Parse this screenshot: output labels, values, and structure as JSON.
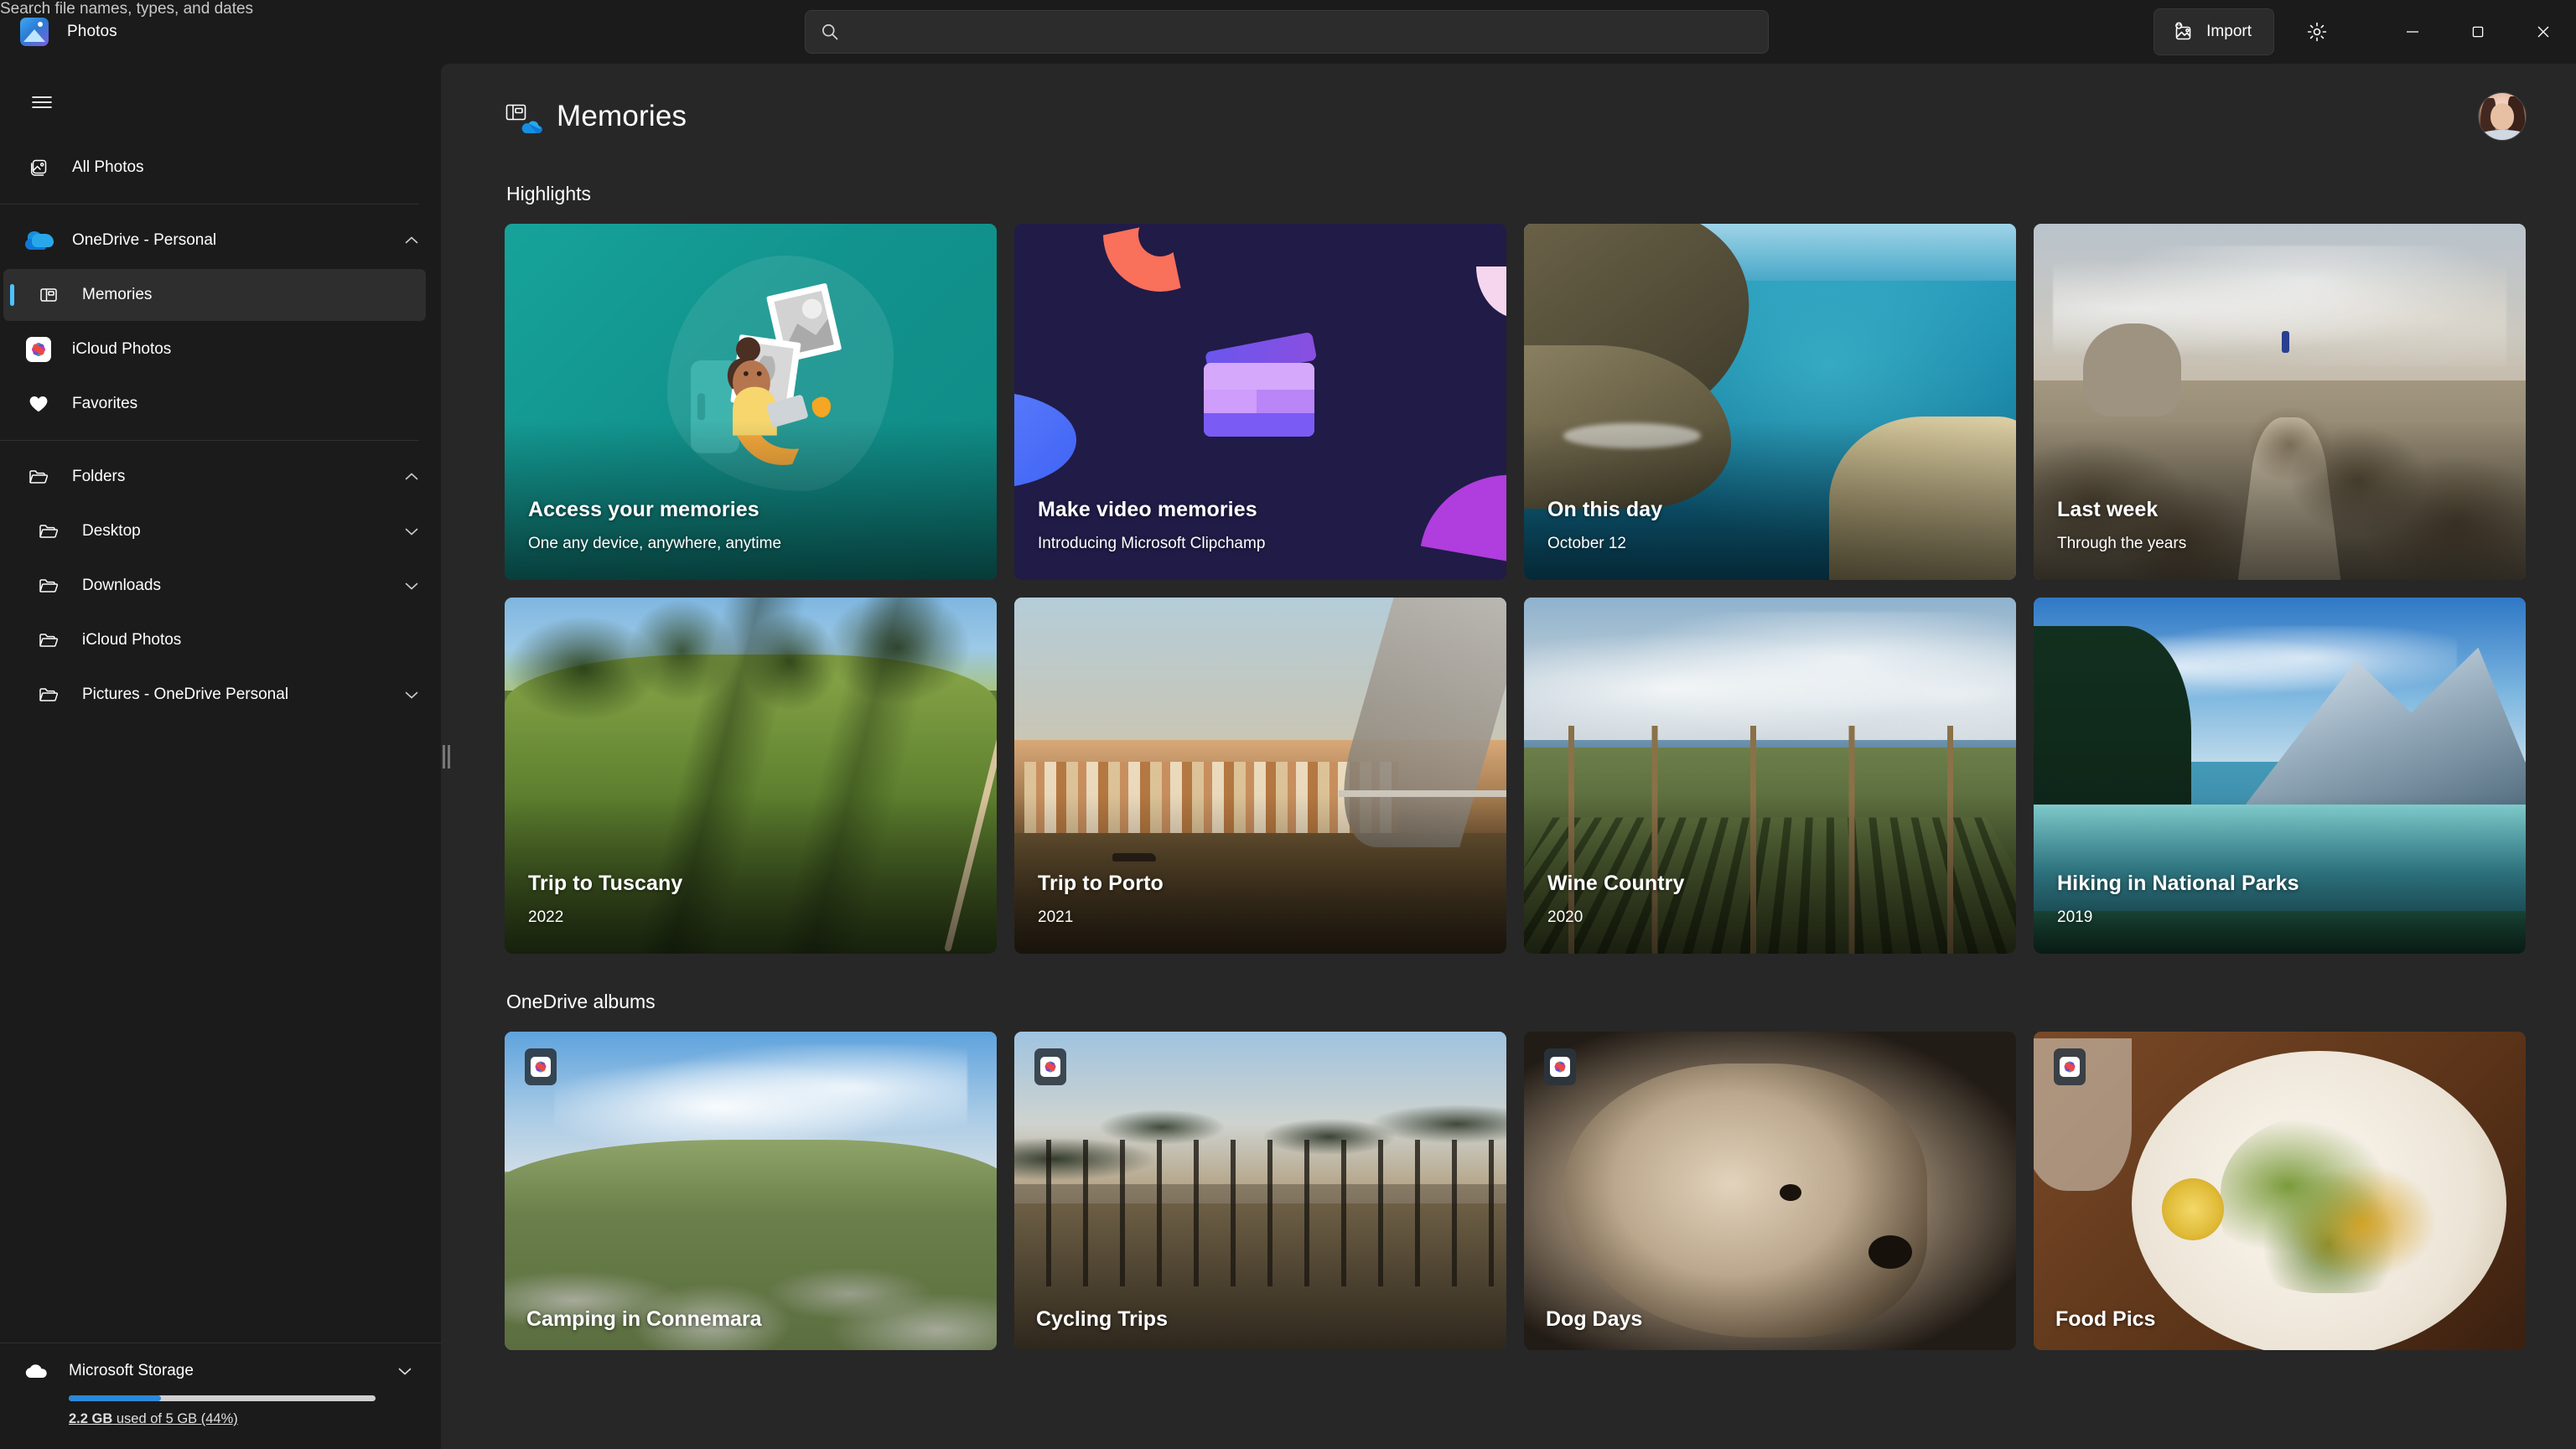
{
  "titlebar": {
    "app_name": "Photos",
    "app_icon": "photos-app-icon",
    "search": {
      "icon": "search-icon",
      "placeholder": "Search file names, types, and dates",
      "value": ""
    },
    "import_label": "Import",
    "import_icon": "import-image-icon",
    "settings_icon": "gear-icon",
    "window_controls": {
      "minimize": "minimize-icon",
      "maximize": "maximize-icon",
      "close": "close-icon"
    }
  },
  "sidebar": {
    "menu_icon": "hamburger-icon",
    "items": [
      {
        "label": "All Photos",
        "icon": "photo-stack-icon",
        "level": 0,
        "chevron": "",
        "selected": false
      },
      {
        "label": "OneDrive - Personal",
        "icon": "onedrive-cloud-icon",
        "level": 0,
        "chevron": "up",
        "selected": false
      },
      {
        "label": "Memories",
        "icon": "memories-book-icon",
        "level": 1,
        "chevron": "",
        "selected": true
      },
      {
        "label": "iCloud Photos",
        "icon": "icloud-photos-icon",
        "level": 0,
        "chevron": "",
        "selected": false
      },
      {
        "label": "Favorites",
        "icon": "heart-icon",
        "level": 0,
        "chevron": "",
        "selected": false
      },
      {
        "label": "Folders",
        "icon": "folder-icon",
        "level": 0,
        "chevron": "up",
        "selected": false
      },
      {
        "label": "Desktop",
        "icon": "folder-icon",
        "level": 1,
        "chevron": "down",
        "selected": false
      },
      {
        "label": "Downloads",
        "icon": "folder-icon",
        "level": 1,
        "chevron": "down",
        "selected": false
      },
      {
        "label": "iCloud Photos",
        "icon": "folder-icon",
        "level": 1,
        "chevron": "",
        "selected": false
      },
      {
        "label": "Pictures - OneDrive Personal",
        "icon": "folder-icon",
        "level": 1,
        "chevron": "down",
        "selected": false
      }
    ],
    "storage": {
      "icon": "cloud-icon",
      "title": "Microsoft Storage",
      "chevron": "down",
      "used_label": "2.2 GB",
      "detail": " used of 5 GB (44%)",
      "percent": 44,
      "bar_color": "#2b88d8"
    },
    "splitter": "sidebar-splitter"
  },
  "main": {
    "page_title": "Memories",
    "page_icon": "memories-onedrive-icon",
    "avatar": "user-avatar",
    "sections": [
      {
        "id": "highlights",
        "title": "Highlights"
      },
      {
        "id": "onedrive-albums",
        "title": "OneDrive albums"
      }
    ],
    "highlights": [
      {
        "title": "Access your memories",
        "subtitle": "One any device, anywhere, anytime",
        "kind": "promo-teal"
      },
      {
        "title": "Make video memories",
        "subtitle": "Introducing Microsoft Clipchamp",
        "kind": "promo-clipchamp"
      },
      {
        "title": "On this day",
        "subtitle": "October 12",
        "kind": "photo-coast"
      },
      {
        "title": "Last week",
        "subtitle": "Through the years",
        "kind": "photo-desert"
      },
      {
        "title": "Trip to Tuscany",
        "subtitle": "2022",
        "kind": "photo-tuscany"
      },
      {
        "title": "Trip to Porto",
        "subtitle": "2021",
        "kind": "photo-porto"
      },
      {
        "title": "Wine Country",
        "subtitle": "2020",
        "kind": "photo-wine"
      },
      {
        "title": "Hiking in National Parks",
        "subtitle": "2019",
        "kind": "photo-hiking"
      }
    ],
    "albums": [
      {
        "title": "Camping in Connemara",
        "badge": "icloud-photos-icon",
        "kind": "photo-connemara"
      },
      {
        "title": "Cycling Trips",
        "badge": "icloud-photos-icon",
        "kind": "photo-cycling"
      },
      {
        "title": "Dog Days",
        "badge": "icloud-photos-icon",
        "kind": "photo-dog"
      },
      {
        "title": "Food Pics",
        "badge": "icloud-photos-icon",
        "kind": "photo-food"
      }
    ]
  },
  "colors": {
    "window_bg": "#1b1b1b",
    "content_bg": "#272727",
    "accent": "#4cc2ff",
    "selected_row": "#2e2e2e",
    "teal_card": "#12938d",
    "clipchamp_card": "#211b47"
  }
}
